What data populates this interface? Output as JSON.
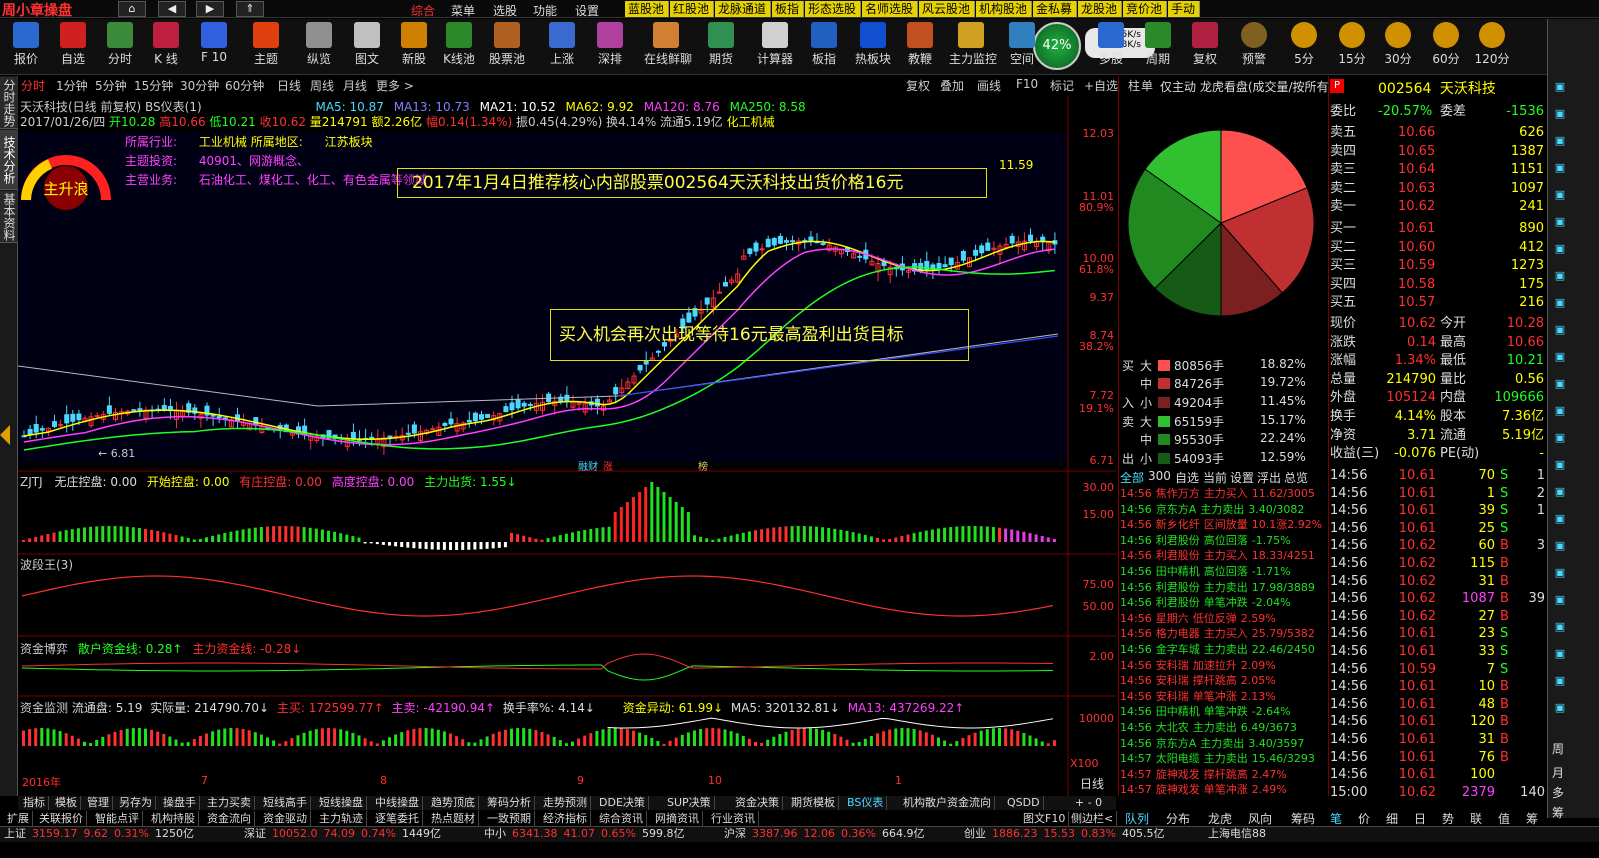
{
  "app": {
    "title": "周小章操盘",
    "menu": [
      "综合",
      "菜单",
      "选股",
      "功能",
      "设置"
    ],
    "pools": [
      "蓝股池",
      "红股池",
      "龙脉通道",
      "板指",
      "形态选股",
      "名师选股",
      "风云股池",
      "机构股池",
      "金私募",
      "龙股池",
      "竞价池",
      "手动"
    ]
  },
  "toolbar": {
    "items": [
      "报价",
      "自选",
      "分时",
      "K 线",
      "F 10",
      "主题",
      "纵览",
      "图文",
      "新股",
      "K线池",
      "股票池",
      "上涨",
      "深排",
      "在线鲜聊",
      "期货",
      "计算器",
      "板指",
      "热板块",
      "教鞭",
      "主力监控",
      "空间"
    ],
    "progress": "42%",
    "net_up": "0.5K/s",
    "net_down": "0.3K/s",
    "periods": [
      "预警",
      "5分",
      "15分",
      "30分",
      "60分",
      "120分"
    ],
    "period_extra": [
      "多股",
      "周期",
      "复权"
    ]
  },
  "left_tabs": [
    "分时走势",
    "技术分析",
    "基本资料"
  ],
  "period_tabs": [
    "分时",
    "1分钟",
    "5分钟",
    "15分钟",
    "30分钟",
    "60分钟",
    "日线",
    "周线",
    "月线",
    "更多 >"
  ],
  "chart_tools": [
    "复权",
    "叠加",
    "画线",
    "F10",
    "标记",
    "+自选",
    "柱",
    "单"
  ],
  "title_line": {
    "name": "天沃科技(日线 前复权) BS仪表(1)",
    "ma5": "MA5: 10.87",
    "ma13": "MA13: 10.73",
    "ma21": "MA21: 10.52",
    "ma62": "MA62: 9.92",
    "ma120": "MA120: 8.76",
    "ma250": "MA250: 8.58"
  },
  "info_line": {
    "date": "2017/01/26/四",
    "open": "开10.28",
    "high": "高10.66",
    "low": "低10.21",
    "close": "收10.62",
    "vol": "量214791",
    "amount": "额2.26亿",
    "chg": "幅0.14(1.34%)",
    "amp": "振0.45(4.29%)",
    "turn": "换4.14%",
    "float": "流通5.19亿",
    "industry": "化工机械"
  },
  "stock_info": {
    "industry_label": "所属行业:",
    "industry": "工业机械",
    "region_label": "所属地区:",
    "region": "江苏板块",
    "theme_label": "主题投资:",
    "theme": "40901、网游概念、",
    "biz_label": "主营业务:",
    "biz": "石油化工、煤化工、化工、有色金属等领域"
  },
  "gauge": {
    "label": "主升浪"
  },
  "annotations": {
    "a1": "2017年1月4日推荐核心内部股票002564天沃科技出货价格16元",
    "a2": "买入机会再次出现等待16元最高盈利出货目标"
  },
  "price_axis": [
    "12.03",
    "11.01",
    "10.00",
    "9.37",
    "8.74",
    "7.72",
    "6.71"
  ],
  "pct_axis": [
    "80.9%",
    "61.8%",
    "38.2%",
    "19.1%"
  ],
  "price_marks": {
    "high": "11.59",
    "low": "6.81"
  },
  "xaxis": [
    "2016年",
    "7",
    "8",
    "9",
    "10",
    "1"
  ],
  "tags": [
    "融财",
    "涨",
    "榜"
  ],
  "indicators": {
    "zjtj": {
      "name": "ZJTJ",
      "items": [
        "无庄控盘: 0.00",
        "开始控盘: 0.00",
        "有庄控盘: 0.00",
        "高度控盘: 0.00",
        "主力出货: 1.55↓"
      ],
      "axis": [
        "30.00",
        "15.00"
      ]
    },
    "bdw": {
      "name": "波段王(3)",
      "axis": [
        "75.00",
        "50.00"
      ]
    },
    "zjby": {
      "name": "资金博弈",
      "items": [
        "散户资金线: 0.28↑",
        "主力资金线: -0.28↓"
      ],
      "axis": [
        "2.00"
      ]
    },
    "zjjc": {
      "name": "资金监测",
      "items": [
        "流通盘: 5.19",
        "实际量: 214790.70↓",
        "主买: 172599.77↑",
        "主卖: -42190.94↑",
        "换手率%: 4.14↓",
        "资金异动: 61.99↓",
        "MA5: 320132.81↓",
        "MA13: 437269.22↑"
      ],
      "axis": [
        "10000"
      ],
      "scale": "X100"
    }
  },
  "right_header": {
    "title": "仅主动 龙虎看盘(成交量/按所有)"
  },
  "pie": {
    "slices": [
      {
        "label": "大买",
        "value": 18.82,
        "color": "#ff5050"
      },
      {
        "label": "中买",
        "value": 19.72,
        "color": "#c03030"
      },
      {
        "label": "小买",
        "value": 11.45,
        "color": "#7a2020"
      },
      {
        "label": "大卖",
        "value": 15.17,
        "color": "#30c030"
      },
      {
        "label": "中卖",
        "value": 22.24,
        "color": "#208a20"
      },
      {
        "label": "小卖",
        "value": 12.59,
        "color": "#155a15"
      }
    ]
  },
  "flow": {
    "buy": [
      [
        "买",
        "大",
        "80856手",
        "18.82%",
        "#ff5050"
      ],
      [
        "",
        "中",
        "84726手",
        "19.72%",
        "#c03030"
      ],
      [
        "入",
        "小",
        "49204手",
        "11.45%",
        "#7a2020"
      ]
    ],
    "sell": [
      [
        "卖",
        "大",
        "65159手",
        "15.17%",
        "#30c030"
      ],
      [
        "",
        "中",
        "95530手",
        "22.24%",
        "#208a20"
      ],
      [
        "出",
        "小",
        "54093手",
        "12.59%",
        "#155a15"
      ]
    ]
  },
  "news_tabs": [
    "全部",
    "300",
    "自选",
    "当前",
    "设置",
    "浮出",
    "总览"
  ],
  "news": [
    [
      "14:56",
      "焦作万方",
      "主力买入",
      "11.62/3005",
      "r"
    ],
    [
      "14:56",
      "京东方A",
      "主力卖出",
      "3.40/3082",
      "g"
    ],
    [
      "14:56",
      "新乡化纤",
      "区间放量",
      "10.1涨2.92%",
      "r"
    ],
    [
      "14:56",
      "利君股份",
      "高位回落",
      "-1.75%",
      "g"
    ],
    [
      "14:56",
      "利君股份",
      "主力买入",
      "18.33/4251",
      "r"
    ],
    [
      "14:56",
      "田中精机",
      "高位回落",
      "-1.71%",
      "g"
    ],
    [
      "14:56",
      "利君股份",
      "主力卖出",
      "17.98/3889",
      "g"
    ],
    [
      "14:56",
      "利君股份",
      "单笔冲跌",
      "-2.04%",
      "g"
    ],
    [
      "14:56",
      "星期六",
      "低位反弹",
      "2.59%",
      "r"
    ],
    [
      "14:56",
      "格力电器",
      "主力买入",
      "25.79/5382",
      "r"
    ],
    [
      "14:56",
      "金字车城",
      "主力卖出",
      "22.46/2450",
      "g"
    ],
    [
      "14:56",
      "安科瑞",
      "加速拉升",
      "2.09%",
      "r"
    ],
    [
      "14:56",
      "安科瑞",
      "撑杆跳高",
      "2.05%",
      "r"
    ],
    [
      "14:56",
      "安科瑞",
      "单笔冲涨",
      "2.13%",
      "r"
    ],
    [
      "14:56",
      "田中精机",
      "单笔冲跌",
      "-2.64%",
      "g"
    ],
    [
      "14:56",
      "大北农",
      "主力卖出",
      "6.49/3673",
      "g"
    ],
    [
      "14:56",
      "京东方A",
      "主力卖出",
      "3.40/3597",
      "g"
    ],
    [
      "14:57",
      "太阳电缆",
      "主力卖出",
      "15.46/3293",
      "g"
    ],
    [
      "14:57",
      "旋神戏发",
      "撑杆跳高",
      "2.47%",
      "r"
    ],
    [
      "14:57",
      "旋神戏发",
      "单笔冲涨",
      "2.49%",
      "r"
    ]
  ],
  "news_footer": [
    "队列",
    "分布",
    "龙虎",
    "风向",
    "筹码"
  ],
  "quote": {
    "code": "002564",
    "name": "天沃科技",
    "wb_label": "委比",
    "wb": "-20.57%",
    "wc_label": "委差",
    "wc": "-1536",
    "asks": [
      [
        "卖五",
        "10.66",
        "626"
      ],
      [
        "卖四",
        "10.65",
        "1387"
      ],
      [
        "卖三",
        "10.64",
        "1151"
      ],
      [
        "卖二",
        "10.63",
        "1097"
      ],
      [
        "卖一",
        "10.62",
        "241"
      ]
    ],
    "bids": [
      [
        "买一",
        "10.61",
        "890"
      ],
      [
        "买二",
        "10.60",
        "412"
      ],
      [
        "买三",
        "10.59",
        "1273"
      ],
      [
        "买四",
        "10.58",
        "175"
      ],
      [
        "买五",
        "10.57",
        "216"
      ]
    ],
    "stats": [
      [
        "现价",
        "10.62",
        "今开",
        "10.28"
      ],
      [
        "涨跌",
        "0.14",
        "最高",
        "10.66"
      ],
      [
        "涨幅",
        "1.34%",
        "最低",
        "10.21"
      ],
      [
        "总量",
        "214790",
        "量比",
        "0.56"
      ],
      [
        "外盘",
        "105124",
        "内盘",
        "109666"
      ],
      [
        "换手",
        "4.14%",
        "股本",
        "7.36亿"
      ],
      [
        "净资",
        "3.71",
        "流通",
        "5.19亿"
      ],
      [
        "收益(三)",
        "-0.076",
        "PE(动)",
        "-"
      ]
    ],
    "ticks": [
      [
        "14:56",
        "10.61",
        "70",
        "S"
      ],
      [
        "14:56",
        "10.61",
        "1",
        "S"
      ],
      [
        "14:56",
        "10.61",
        "39",
        "S"
      ],
      [
        "14:56",
        "10.61",
        "25",
        "S"
      ],
      [
        "14:56",
        "10.62",
        "60",
        "B"
      ],
      [
        "14:56",
        "10.62",
        "115",
        "B"
      ],
      [
        "14:56",
        "10.62",
        "31",
        "B"
      ],
      [
        "14:56",
        "10.62",
        "1087",
        "B"
      ],
      [
        "14:56",
        "10.62",
        "27",
        "B"
      ],
      [
        "14:56",
        "10.61",
        "23",
        "S"
      ],
      [
        "14:56",
        "10.61",
        "33",
        "S"
      ],
      [
        "14:56",
        "10.59",
        "7",
        "S"
      ],
      [
        "14:56",
        "10.61",
        "10",
        "B"
      ],
      [
        "14:56",
        "10.61",
        "48",
        "B"
      ],
      [
        "14:56",
        "10.61",
        "120",
        "B"
      ],
      [
        "14:56",
        "10.61",
        "31",
        "B"
      ],
      [
        "14:56",
        "10.61",
        "76",
        "B"
      ],
      [
        "14:56",
        "10.61",
        "100",
        ""
      ],
      [
        "15:00",
        "10.62",
        "2379",
        ""
      ]
    ],
    "tick_extra": [
      "1",
      "2",
      "1",
      "",
      "3",
      "",
      "",
      "39",
      "",
      "",
      "",
      "",
      "",
      "",
      "",
      "",
      "",
      "",
      "140"
    ],
    "footer": [
      "笔",
      "价",
      "细",
      "日",
      "势",
      "联",
      "值",
      "筹"
    ]
  },
  "right_sidebar": [
    "周",
    "月",
    "多",
    "筹"
  ],
  "bottom_tabs": [
    "指标",
    "模板",
    "管理",
    "另存为",
    "操盘手",
    "主力买卖",
    "短线高手",
    "短线操盘",
    "中线操盘",
    "趋势顶底",
    "筹码分析",
    "走势预测",
    "DDE决策",
    "SUP决策",
    "资金决策",
    "期货模板",
    "BS仪表",
    "机构散户资金流向",
    "QSDD"
  ],
  "bottom_tabs2": [
    "扩展",
    "关联报价",
    "智能点评",
    "机构持股",
    "资金流向",
    "资金驱动",
    "主力轨迹",
    "逐笔委托",
    "热点题材",
    "一致预期",
    "经济指标",
    "综合资讯",
    "网摘资讯",
    "行业资讯"
  ],
  "bottom_right": [
    "图文F10",
    "侧边栏<"
  ],
  "xaxis_right": "日线",
  "status": [
    [
      "上证",
      "3159.17",
      "9.62",
      "0.31%",
      "1250亿"
    ],
    [
      "深证",
      "10052.0",
      "74.09",
      "0.74%",
      "1449亿"
    ],
    [
      "中小",
      "6341.38",
      "41.07",
      "0.65%",
      "599.8亿"
    ],
    [
      "沪深",
      "3387.96",
      "12.06",
      "0.36%",
      "664.9亿"
    ],
    [
      "创业",
      "1886.23",
      "15.53",
      "0.83%",
      "405.5亿"
    ]
  ],
  "status_extra": "上海电信88"
}
